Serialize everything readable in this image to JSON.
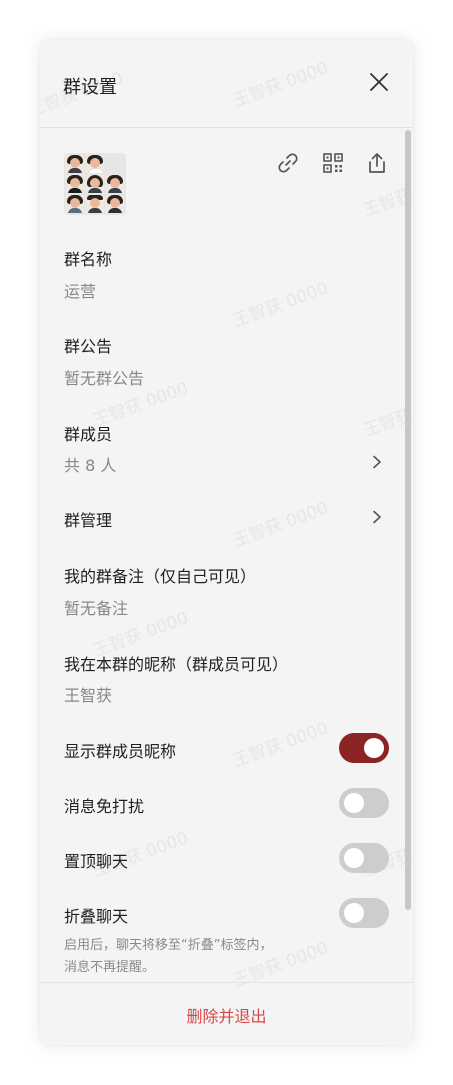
{
  "panel": {
    "title": "群设置",
    "watermark": "王智获 0000"
  },
  "toolbar": {
    "icons": [
      "close-icon",
      "link-icon",
      "qrcode-icon",
      "share-icon"
    ]
  },
  "group_name": {
    "label": "群名称",
    "value": "运营"
  },
  "announcement": {
    "label": "群公告",
    "value": "暂无群公告"
  },
  "members": {
    "label": "群成员",
    "value": "共 8 人"
  },
  "manage": {
    "label": "群管理"
  },
  "my_remark": {
    "label": "我的群备注（仅自己可见）",
    "value": "暂无备注"
  },
  "my_nickname": {
    "label": "我在本群的昵称（群成员可见）",
    "value": "王智获"
  },
  "toggles": {
    "show_member_nickname": {
      "label": "显示群成员昵称",
      "on": true
    },
    "mute": {
      "label": "消息免打扰",
      "on": false
    },
    "pin": {
      "label": "置顶聊天",
      "on": false
    },
    "fold": {
      "label": "折叠聊天",
      "on": false
    }
  },
  "fold_hint_line1": "启用后，聊天将移至“折叠”标签内，",
  "fold_hint_line2": "消息不再提醒。",
  "footer": {
    "exit_label": "删除并退出"
  },
  "colors": {
    "accent": "#8c2424",
    "danger": "#d94848",
    "toggle_off": "#cdcdd0"
  }
}
